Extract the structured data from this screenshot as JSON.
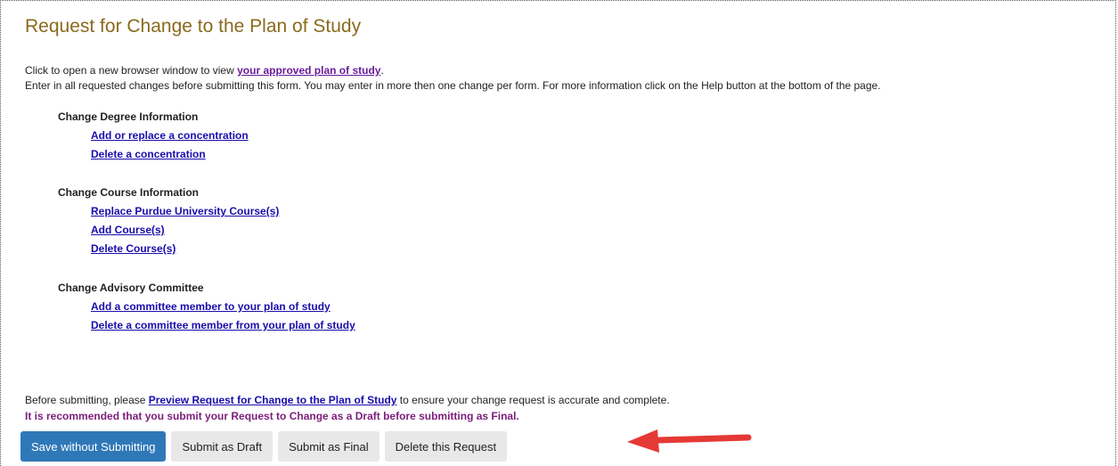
{
  "page": {
    "title": "Request for Change to the Plan of Study",
    "intro_line1_prefix": "Click to open a new browser window to view ",
    "intro_line1_link": "your approved plan of study",
    "intro_line1_suffix": ".",
    "intro_line2": "Enter in all requested changes before submitting this form. You may enter in more then one change per form. For more information click on the Help button at the bottom of the page."
  },
  "sections": [
    {
      "heading": "Change Degree Information",
      "links": [
        "Add or replace a concentration",
        "Delete a concentration"
      ]
    },
    {
      "heading": "Change Course Information",
      "links": [
        "Replace Purdue University Course(s)",
        "Add Course(s)",
        "Delete Course(s)"
      ]
    },
    {
      "heading": "Change Advisory Committee",
      "links": [
        "Add a committee member to your plan of study",
        "Delete a committee member from your plan of study"
      ]
    }
  ],
  "footer": {
    "before_prefix": "Before submitting, please ",
    "before_link": "Preview Request for Change to the Plan of Study",
    "before_suffix": " to ensure your change request is accurate and complete.",
    "recommendation": "It is recommended that you submit your Request to Change as a Draft before submitting as Final."
  },
  "buttons": {
    "save": "Save without Submitting",
    "draft": "Submit as Draft",
    "final": "Submit as Final",
    "delete": "Delete this Request"
  },
  "colors": {
    "title": "#8a6a1c",
    "link": "#1a0dab",
    "visited_link": "#6a1b9a",
    "recommendation": "#7b1e7a",
    "primary_button": "#2f78b8",
    "annotation_arrow": "#e53935"
  },
  "icons": {
    "annotation": "red-arrow-icon"
  }
}
